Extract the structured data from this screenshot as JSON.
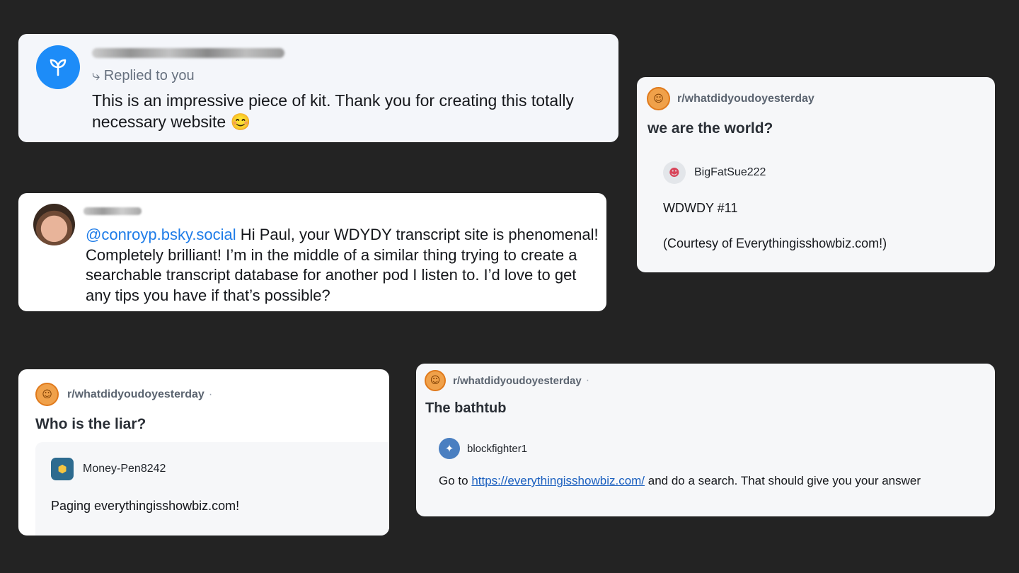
{
  "bluesky_reply": {
    "replied_label": "⤷ Replied to you",
    "body": "This is an impressive piece of kit. Thank you for creating this totally necessary website 😊"
  },
  "bluesky_mention": {
    "mention": "@conroyp.bsky.social",
    "body": " Hi Paul, your WDYDY transcript site is phenomenal! Completely brilliant! I’m in the middle of a similar thing trying to create a searchable transcript database for another pod I listen to. I’d love to get any tips you have if that’s possible?"
  },
  "reddit_post_1": {
    "subreddit": "r/whatdidyoudoyesterday",
    "title": "we are the world?",
    "username": "BigFatSue222",
    "comment_line1": "WDWDY #11",
    "comment_line2": "(Courtesy of Everythingisshowbiz.com!)"
  },
  "reddit_post_2": {
    "subreddit": "r/whatdidyoudoyesterday",
    "dot": "·",
    "title": "Who is the liar?",
    "username": "Money-Pen8242",
    "comment": "Paging everythingisshowbiz.com!"
  },
  "reddit_post_3": {
    "subreddit": "r/whatdidyoudoyesterday",
    "dot": "·",
    "title": "The bathtub",
    "username": "blockfighter1",
    "comment_prefix": "Go to ",
    "comment_link": "https://everythingisshowbiz.com/",
    "comment_suffix": " and do a search. That should give you your answer"
  },
  "icons": {
    "bluesky_avatar": "sprout-icon",
    "subreddit_icon": "subreddit-avatar-icon"
  },
  "colors": {
    "background": "#232323",
    "mention_blue": "#1e7ce8",
    "link_blue": "#1a5fbf"
  }
}
